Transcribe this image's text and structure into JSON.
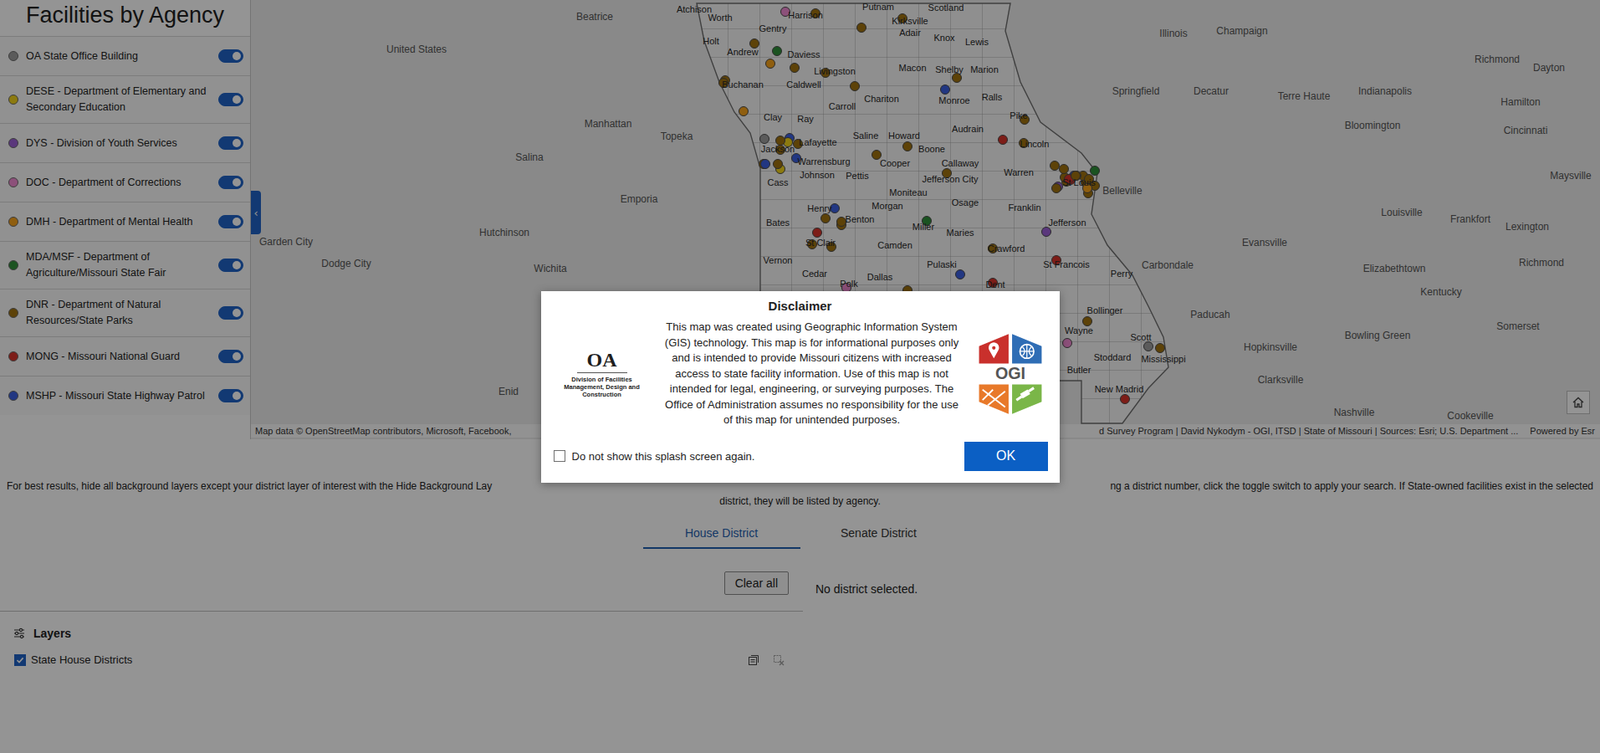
{
  "sidebar": {
    "title": "Facilities by Agency",
    "collapse_icon": "‹",
    "agencies": [
      {
        "label": "OA State Office Building",
        "color": "#9e9e9e",
        "on": true
      },
      {
        "label": "DESE - Department of Elementary and Secondary Education",
        "color": "#f2d31b",
        "on": true
      },
      {
        "label": "DYS - Division of Youth Services",
        "color": "#9b5fd6",
        "on": true
      },
      {
        "label": "DOC - Department of Corrections",
        "color": "#f28bd2",
        "on": true
      },
      {
        "label": "DMH - Department of Mental Health",
        "color": "#f7a21b",
        "on": true
      },
      {
        "label": "MDA/MSF - Department of Agriculture/Missouri State Fair",
        "color": "#2f8f3a",
        "on": true
      },
      {
        "label": "DNR - Department of Natural Resources/State Parks",
        "color": "#a0720f",
        "on": true
      },
      {
        "label": "MONG - Missouri National Guard",
        "color": "#d8332a",
        "on": true
      },
      {
        "label": "MSHP - Missouri State Highway Patrol",
        "color": "#3b5fe0",
        "on": true
      }
    ]
  },
  "map": {
    "labels": [
      {
        "text": "Beatrice",
        "kind": "region"
      },
      {
        "text": "United States",
        "kind": "region"
      },
      {
        "text": "Manhattan",
        "kind": "region"
      },
      {
        "text": "Topeka",
        "kind": "region"
      },
      {
        "text": "Salina",
        "kind": "region"
      },
      {
        "text": "Emporia",
        "kind": "region"
      },
      {
        "text": "Hutchinson",
        "kind": "region"
      },
      {
        "text": "Garden City",
        "kind": "region"
      },
      {
        "text": "Dodge City",
        "kind": "region"
      },
      {
        "text": "Wichita",
        "kind": "region"
      },
      {
        "text": "Enid",
        "kind": "region"
      },
      {
        "text": "Illinois",
        "kind": "region"
      },
      {
        "text": "Champaign",
        "kind": "region"
      },
      {
        "text": "Springfield",
        "kind": "region"
      },
      {
        "text": "Decatur",
        "kind": "region"
      },
      {
        "text": "Terre Haute",
        "kind": "region"
      },
      {
        "text": "Indianapolis",
        "kind": "region"
      },
      {
        "text": "Richmond",
        "kind": "region"
      },
      {
        "text": "Dayton",
        "kind": "region"
      },
      {
        "text": "Hamilton",
        "kind": "region"
      },
      {
        "text": "Bloomington",
        "kind": "region"
      },
      {
        "text": "Cincinnati",
        "kind": "region"
      },
      {
        "text": "Maysville",
        "kind": "region"
      },
      {
        "text": "Belleville",
        "kind": "region"
      },
      {
        "text": "Louisville",
        "kind": "region"
      },
      {
        "text": "Frankfort",
        "kind": "region"
      },
      {
        "text": "Lexington",
        "kind": "region"
      },
      {
        "text": "Evansville",
        "kind": "region"
      },
      {
        "text": "Carbondale",
        "kind": "region"
      },
      {
        "text": "Richmond",
        "kind": "region"
      },
      {
        "text": "Elizabethtown",
        "kind": "region"
      },
      {
        "text": "Kentucky",
        "kind": "region"
      },
      {
        "text": "Paducah",
        "kind": "region"
      },
      {
        "text": "Somerset",
        "kind": "region"
      },
      {
        "text": "Bowling Green",
        "kind": "region"
      },
      {
        "text": "Hopkinsville",
        "kind": "region"
      },
      {
        "text": "Clarksville",
        "kind": "region"
      },
      {
        "text": "Nashville",
        "kind": "region"
      },
      {
        "text": "Cookeville",
        "kind": "region"
      },
      {
        "text": "Atchison",
        "kind": "county"
      },
      {
        "text": "Worth",
        "kind": "county"
      },
      {
        "text": "Harrison",
        "kind": "county"
      },
      {
        "text": "Putnam",
        "kind": "county"
      },
      {
        "text": "Scotland",
        "kind": "county"
      },
      {
        "text": "Gentry",
        "kind": "county"
      },
      {
        "text": "Kirksville",
        "kind": "county"
      },
      {
        "text": "Holt",
        "kind": "county"
      },
      {
        "text": "Adair",
        "kind": "county"
      },
      {
        "text": "Knox",
        "kind": "county"
      },
      {
        "text": "Lewis",
        "kind": "county"
      },
      {
        "text": "Andrew",
        "kind": "county"
      },
      {
        "text": "Daviess",
        "kind": "county"
      },
      {
        "text": "Livingston",
        "kind": "county"
      },
      {
        "text": "Macon",
        "kind": "county"
      },
      {
        "text": "Shelby",
        "kind": "county"
      },
      {
        "text": "Marion",
        "kind": "county"
      },
      {
        "text": "Buchanan",
        "kind": "county"
      },
      {
        "text": "Caldwell",
        "kind": "county"
      },
      {
        "text": "Ralls",
        "kind": "county"
      },
      {
        "text": "Chariton",
        "kind": "county"
      },
      {
        "text": "Monroe",
        "kind": "county"
      },
      {
        "text": "Carroll",
        "kind": "county"
      },
      {
        "text": "Pike",
        "kind": "county"
      },
      {
        "text": "Clay",
        "kind": "county"
      },
      {
        "text": "Ray",
        "kind": "county"
      },
      {
        "text": "Audrain",
        "kind": "county"
      },
      {
        "text": "Saline",
        "kind": "county"
      },
      {
        "text": "Howard",
        "kind": "county"
      },
      {
        "text": "Lafayette",
        "kind": "county"
      },
      {
        "text": "Lincoln",
        "kind": "county"
      },
      {
        "text": "Jackson",
        "kind": "county"
      },
      {
        "text": "Boone",
        "kind": "county"
      },
      {
        "text": "Cooper",
        "kind": "county"
      },
      {
        "text": "Callaway",
        "kind": "county"
      },
      {
        "text": "Warrensburg",
        "kind": "county"
      },
      {
        "text": "Warren",
        "kind": "county"
      },
      {
        "text": "Johnson",
        "kind": "county"
      },
      {
        "text": "Pettis",
        "kind": "county"
      },
      {
        "text": "St Louis",
        "kind": "county"
      },
      {
        "text": "Cass",
        "kind": "county"
      },
      {
        "text": "Jefferson City",
        "kind": "county"
      },
      {
        "text": "Moniteau",
        "kind": "county"
      },
      {
        "text": "Osage",
        "kind": "county"
      },
      {
        "text": "Morgan",
        "kind": "county"
      },
      {
        "text": "Franklin",
        "kind": "county"
      },
      {
        "text": "Henry",
        "kind": "county"
      },
      {
        "text": "Benton",
        "kind": "county"
      },
      {
        "text": "Jefferson",
        "kind": "county"
      },
      {
        "text": "Bates",
        "kind": "county"
      },
      {
        "text": "Miller",
        "kind": "county"
      },
      {
        "text": "Maries",
        "kind": "county"
      },
      {
        "text": "St Clair",
        "kind": "county"
      },
      {
        "text": "Camden",
        "kind": "county"
      },
      {
        "text": "Crawford",
        "kind": "county"
      },
      {
        "text": "Vernon",
        "kind": "county"
      },
      {
        "text": "Pulaski",
        "kind": "county"
      },
      {
        "text": "St Francois",
        "kind": "county"
      },
      {
        "text": "Cedar",
        "kind": "county"
      },
      {
        "text": "Perry",
        "kind": "county"
      },
      {
        "text": "Dallas",
        "kind": "county"
      },
      {
        "text": "Polk",
        "kind": "county"
      },
      {
        "text": "Dent",
        "kind": "county"
      },
      {
        "text": "Bollinger",
        "kind": "county"
      },
      {
        "text": "Wayne",
        "kind": "county"
      },
      {
        "text": "Scott",
        "kind": "county"
      },
      {
        "text": "Mississippi",
        "kind": "county"
      },
      {
        "text": "Stoddard",
        "kind": "county"
      },
      {
        "text": "Butler",
        "kind": "county"
      },
      {
        "text": "New Madrid",
        "kind": "county"
      }
    ],
    "pins": [
      {
        "color": "#a0720f"
      },
      {
        "color": "#a0720f"
      },
      {
        "color": "#d8332a"
      },
      {
        "color": "#a0720f"
      },
      {
        "color": "#3b5fe0"
      },
      {
        "color": "#a0720f"
      },
      {
        "color": "#2f8f3a"
      },
      {
        "color": "#a0720f"
      },
      {
        "color": "#a0720f"
      },
      {
        "color": "#d8332a"
      },
      {
        "color": "#f28bd2"
      },
      {
        "color": "#a0720f"
      },
      {
        "color": "#a0720f"
      },
      {
        "color": "#3b5fe0"
      },
      {
        "color": "#a0720f"
      },
      {
        "color": "#f7a21b"
      },
      {
        "color": "#a0720f"
      },
      {
        "color": "#a0720f"
      },
      {
        "color": "#d8332a"
      },
      {
        "color": "#a0720f"
      },
      {
        "color": "#9e9e9e"
      },
      {
        "color": "#a0720f"
      },
      {
        "color": "#a0720f"
      },
      {
        "color": "#9b5fd6"
      },
      {
        "color": "#a0720f"
      },
      {
        "color": "#3b5fe0"
      },
      {
        "color": "#a0720f"
      },
      {
        "color": "#d8332a"
      },
      {
        "color": "#a0720f"
      },
      {
        "color": "#f2d31b"
      },
      {
        "color": "#a0720f"
      },
      {
        "color": "#a0720f"
      },
      {
        "color": "#2f8f3a"
      },
      {
        "color": "#a0720f"
      },
      {
        "color": "#f28bd2"
      },
      {
        "color": "#a0720f"
      },
      {
        "color": "#d8332a"
      },
      {
        "color": "#a0720f"
      },
      {
        "color": "#a0720f"
      },
      {
        "color": "#3b5fe0"
      },
      {
        "color": "#a0720f"
      },
      {
        "color": "#f7a21b"
      },
      {
        "color": "#a0720f"
      },
      {
        "color": "#a0720f"
      },
      {
        "color": "#d8332a"
      },
      {
        "color": "#a0720f"
      },
      {
        "color": "#9e9e9e"
      },
      {
        "color": "#a0720f"
      },
      {
        "color": "#a0720f"
      },
      {
        "color": "#3b5fe0"
      },
      {
        "color": "#a0720f"
      },
      {
        "color": "#9b5fd6"
      },
      {
        "color": "#a0720f"
      },
      {
        "color": "#f28bd2"
      },
      {
        "color": "#a0720f"
      },
      {
        "color": "#d8332a"
      },
      {
        "color": "#a0720f"
      },
      {
        "color": "#a0720f"
      },
      {
        "color": "#f2d31b"
      },
      {
        "color": "#a0720f"
      },
      {
        "color": "#2f8f3a"
      },
      {
        "color": "#a0720f"
      },
      {
        "color": "#3b5fe0"
      },
      {
        "color": "#a0720f"
      },
      {
        "color": "#d8332a"
      },
      {
        "color": "#a0720f"
      },
      {
        "color": "#a0720f"
      },
      {
        "color": "#f7a21b"
      },
      {
        "color": "#a0720f"
      },
      {
        "color": "#9e9e9e"
      },
      {
        "color": "#a0720f"
      },
      {
        "color": "#a0720f"
      },
      {
        "color": "#f28bd2"
      },
      {
        "color": "#a0720f"
      },
      {
        "color": "#d8332a"
      },
      {
        "color": "#3b5fe0"
      },
      {
        "color": "#a0720f"
      },
      {
        "color": "#a0720f"
      },
      {
        "color": "#9b5fd6"
      },
      {
        "color": "#a0720f"
      }
    ],
    "attribution_left": "Map data © OpenStreetMap contributors, Microsoft, Facebook,",
    "attribution_right": "d Survey Program | David Nykodym - OGI, ITSD | State of Missouri | Sources: Esri; U.S. Department ...",
    "powered_by": "Powered by Esr"
  },
  "instructions": {
    "line1_left": "For best results, hide all background layers except your district layer of interest with the Hide Background Lay",
    "line1_right": "ng a district number, click the toggle switch to apply your search. If State-owned facilities exist in the selected",
    "line2": "district, they will be listed by agency."
  },
  "district_tabs": [
    {
      "label": "House District",
      "selected": true
    },
    {
      "label": "Senate District",
      "selected": false
    }
  ],
  "clear_button": "Clear all",
  "results": {
    "message": "No district selected."
  },
  "layers": {
    "title": "Layers",
    "items": [
      {
        "label": "State House Districts",
        "checked": true
      }
    ]
  },
  "dialog": {
    "title": "Disclaimer",
    "body": "This map was created using Geographic Information System (GIS) technology. This map is for informational purposes only and is intended to provide Missouri citizens with increased access to state facility information. Use of this map is not intended for legal, engineering, or surveying purposes. The Office of Administration assumes no responsibility for the use of this map for unintended purposes.",
    "oa_logo": {
      "mark": "OA",
      "caption": "Division of Facilities Management, Design and Construction"
    },
    "ogi_logo": {
      "text": "OGI"
    },
    "checkbox": {
      "label": "Do not show this splash screen again.",
      "checked": false
    },
    "button": "OK"
  }
}
